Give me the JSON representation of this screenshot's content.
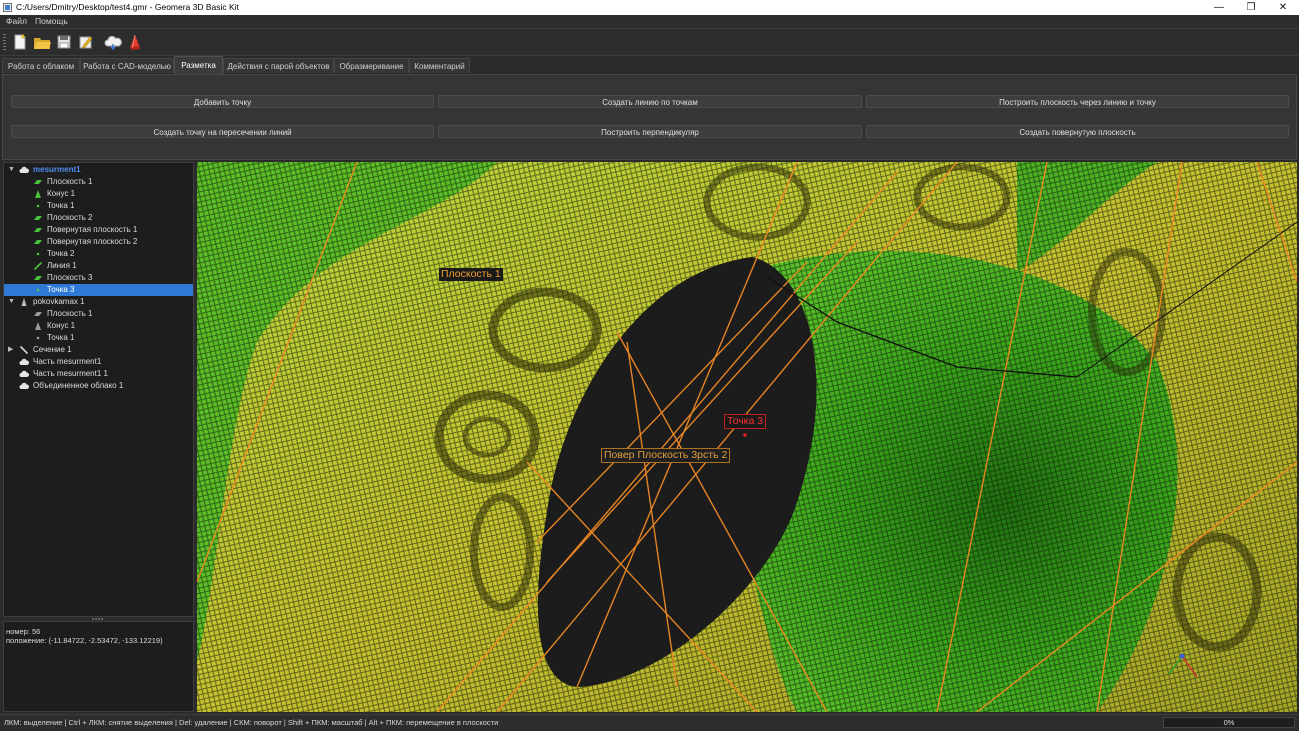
{
  "window": {
    "title": "C:/Users/Dmitry/Desktop/test4.gmr - Geomera 3D Basic Kit",
    "minimize": "—",
    "maximize": "❐",
    "close": "✕"
  },
  "menu": {
    "file": "Файл",
    "help": "Помощь"
  },
  "toolbar": {
    "icons": [
      "new-file-icon",
      "open-folder-icon",
      "save-icon",
      "edit-icon",
      "cloud-icon",
      "cone-icon"
    ]
  },
  "tabs": [
    {
      "label": "Работа с облаком"
    },
    {
      "label": "Работа с CAD-моделью"
    },
    {
      "label": "Разметка",
      "active": true
    },
    {
      "label": "Действия с парой объектов"
    },
    {
      "label": "Образмеривание"
    },
    {
      "label": "Комментарий"
    }
  ],
  "actions": {
    "add_point": "Добавить точку",
    "line_by_points": "Создать линию по точкам",
    "plane_line_point": "Построить плоскость через линию и точку",
    "point_intersection": "Создать точку на пересечении линий",
    "perpendicular": "Построить перпендикуляр",
    "rotated_plane": "Создать повернутую плоскость"
  },
  "tree": {
    "mesurment1": "mesurment1",
    "plane1": "Плоскость 1",
    "cone1": "Конус 1",
    "point1": "Точка 1",
    "plane2": "Плоскость 2",
    "rotated1": "Повернутая плоскость 1",
    "rotated2": "Повернутая плоскость 2",
    "point2": "Точка 2",
    "line1": "Линия 1",
    "plane3": "Плоскость 3",
    "point3": "Точка 3",
    "pokovkamax": "pokovkamax 1",
    "pk_plane1": "Плоскость 1",
    "pk_cone1": "Конус 1",
    "pk_point1": "Точка 1",
    "section1": "Сечение 1",
    "part1": "Часть mesurment1",
    "part2": "Часть mesurment1 1",
    "merged": "Объединенное облако 1"
  },
  "info": {
    "number": "номер: 56",
    "position": "положение: (-11.84722, -2.53472, -133.12219)"
  },
  "viewport": {
    "label_plane1": "Плоскость 1",
    "label_point3": "Точка 3",
    "label_overlap": "Повер Плоскость 3рсть 2",
    "colors": {
      "mesh_green": "#3fb31a",
      "mesh_yellow": "#c8c42a",
      "hole": "#1e1e1e",
      "lines": "#f08a24",
      "point": "#e02020"
    }
  },
  "status": {
    "hint": "ЛКМ: выделение | Ctrl + ЛКМ: снятие выделения | Del: удаление | СКМ: поворот | Shift + ПКМ: масштаб | Alt + ПКМ: перемещение в плоскости",
    "progress": "0%",
    "progress_value": 0
  }
}
